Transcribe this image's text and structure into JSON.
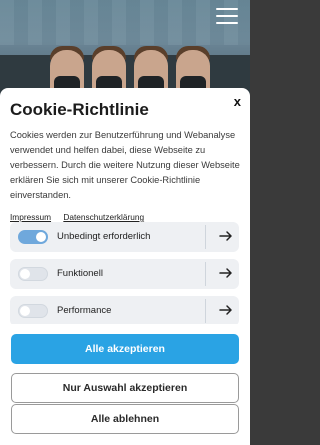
{
  "page": {
    "menu_icon": "hamburger-menu-icon"
  },
  "cookie": {
    "title": "Cookie-Richtlinie",
    "close_label": "x",
    "text": "Cookies werden zur Benutzerführung und Webanalyse verwendet und helfen dabei, diese Webseite zu verbessern. Durch die weitere Nutzung dieser Webseite erklären Sie sich mit unserer Cookie-Richtlinie einverstanden.",
    "links": {
      "impressum": "Impressum",
      "datenschutz": "Datenschutzerklärung"
    },
    "categories": [
      {
        "label": "Unbedingt erforderlich",
        "enabled": true
      },
      {
        "label": "Funktionell",
        "enabled": false
      },
      {
        "label": "Performance",
        "enabled": false
      }
    ],
    "buttons": {
      "accept_all": "Alle akzeptieren",
      "accept_selection": "Nur Auswahl akzeptieren",
      "reject_all": "Alle ablehnen"
    }
  },
  "colors": {
    "primary": "#2aa3e4",
    "toggle_on": "#6fa8dc",
    "row_bg": "#eef0f3"
  }
}
